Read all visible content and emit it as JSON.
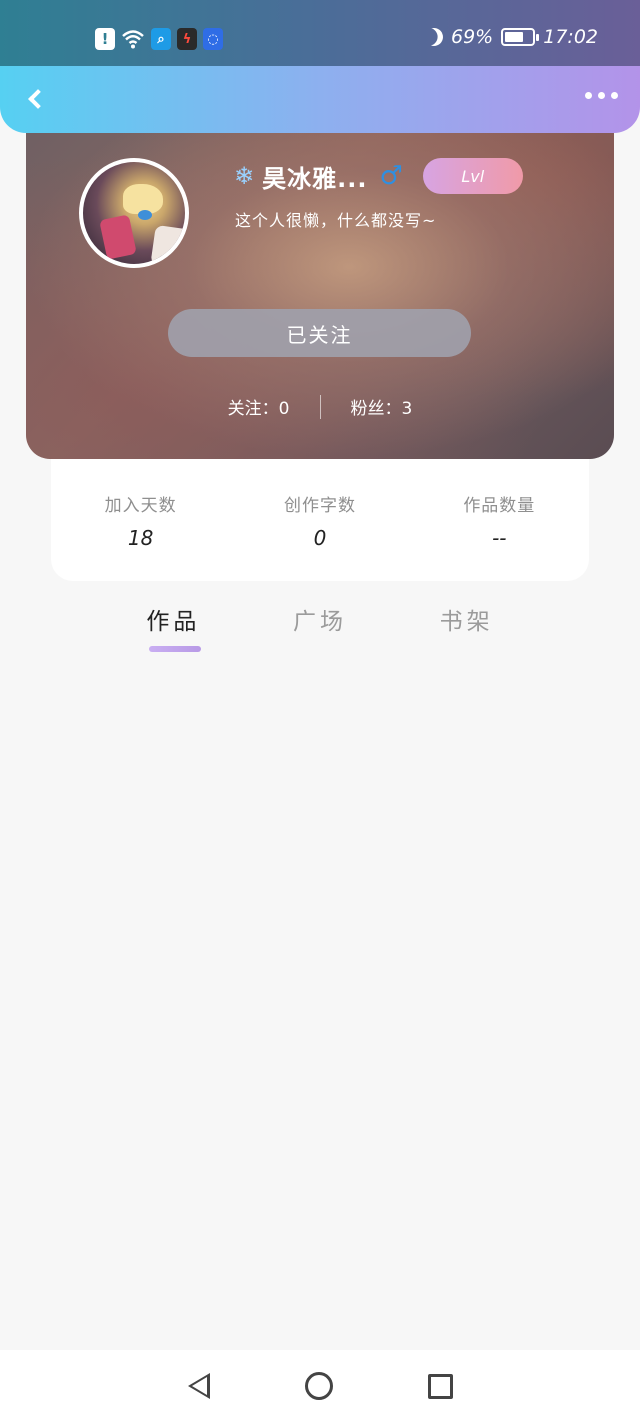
{
  "status_bar": {
    "battery_percent": "69%",
    "time": "17:02",
    "icons": [
      "alert-icon",
      "wifi-icon",
      "search-app-icon",
      "flash-app-icon",
      "bulb-app-icon",
      "moon-icon",
      "battery-icon"
    ]
  },
  "appbar": {
    "back_icon": "chevron-left-icon",
    "more_icon": "more-dots-icon"
  },
  "profile": {
    "name_prefix_icon": "❄",
    "username": "昊冰雅...",
    "gender_icon": "♂",
    "level": "Lvl",
    "bio": "这个人很懒，什么都没写~",
    "follow_button": "已关注",
    "following_text": "关注：0",
    "fans_text": "粉丝：3"
  },
  "stats": {
    "items": [
      {
        "label": "加入天数",
        "value": "18"
      },
      {
        "label": "创作字数",
        "value": "0"
      },
      {
        "label": "作品数量",
        "value": "--"
      }
    ]
  },
  "tabs": {
    "items": [
      {
        "label": "作品"
      },
      {
        "label": "广场"
      },
      {
        "label": "书架"
      }
    ],
    "active_index": 0
  },
  "colors": {
    "appbar_start": "#56d0f2",
    "appbar_end": "#b393e9",
    "tab_indicator": "#c9aef2",
    "level_badge_start": "#d7a4e2",
    "level_badge_end": "#f09aa8"
  }
}
